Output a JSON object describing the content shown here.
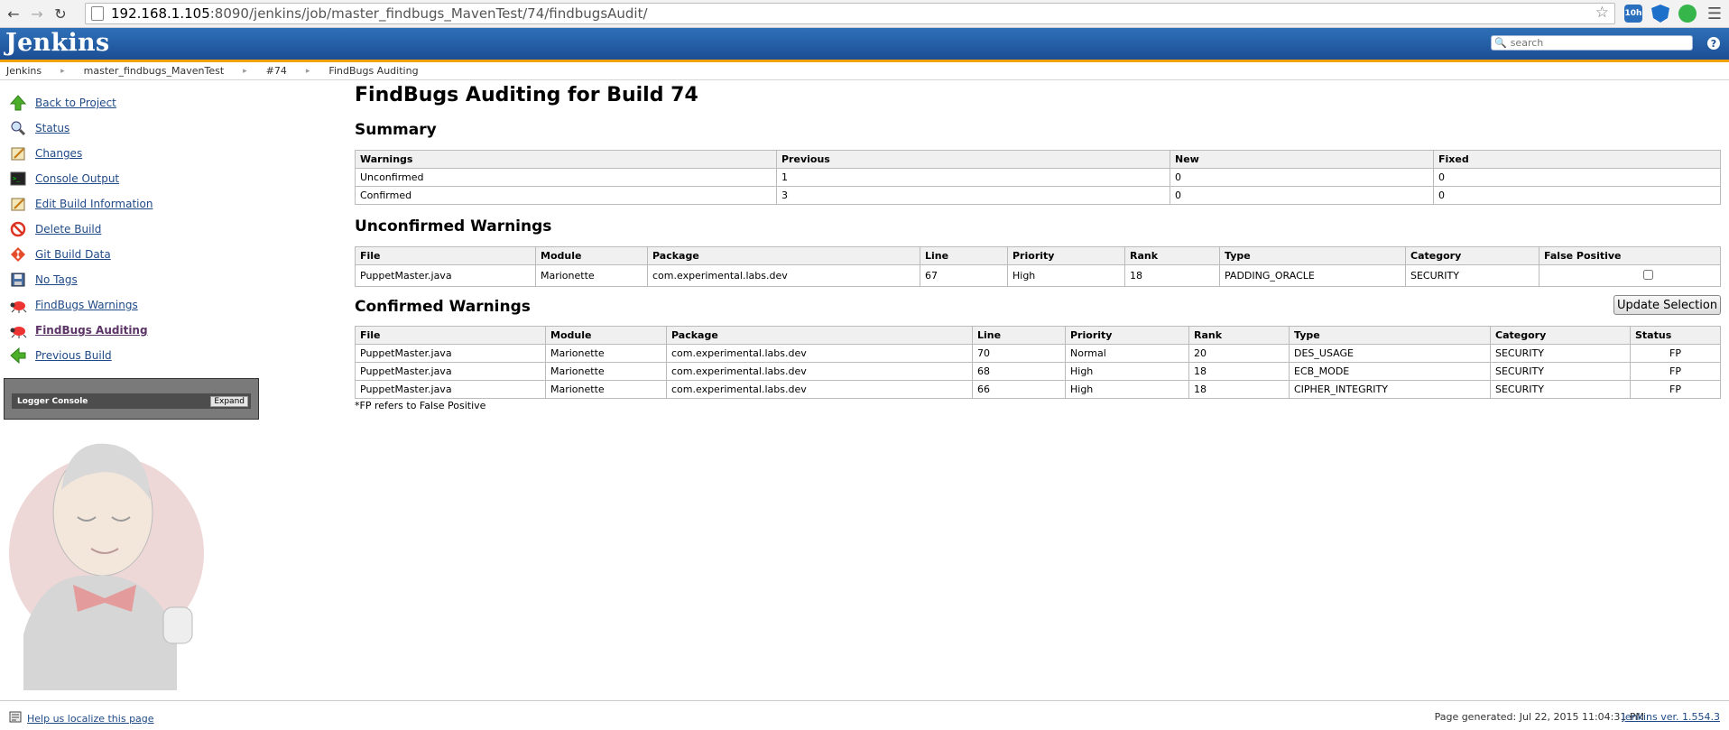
{
  "browser": {
    "url_host": "192.168.1.105",
    "url_path": ":8090/jenkins/job/master_findbugs_MavenTest/74/findbugsAudit/",
    "ext_badge": "10h"
  },
  "header": {
    "logo": "Jenkins",
    "search_placeholder": "search",
    "help": "?"
  },
  "breadcrumb": [
    "Jenkins",
    "master_findbugs_MavenTest",
    "#74",
    "FindBugs Auditing"
  ],
  "sidebar": {
    "items": [
      {
        "label": "Back to Project",
        "icon": "up-arrow-icon"
      },
      {
        "label": "Status",
        "icon": "search-icon"
      },
      {
        "label": "Changes",
        "icon": "notepad-icon"
      },
      {
        "label": "Console Output",
        "icon": "terminal-icon"
      },
      {
        "label": "Edit Build Information",
        "icon": "notepad-icon"
      },
      {
        "label": "Delete Build",
        "icon": "no-entry-icon"
      },
      {
        "label": "Git Build Data",
        "icon": "git-icon"
      },
      {
        "label": "No Tags",
        "icon": "save-icon"
      },
      {
        "label": "FindBugs Warnings",
        "icon": "bug-icon"
      },
      {
        "label": "FindBugs Auditing",
        "icon": "bug-icon"
      },
      {
        "label": "Previous Build",
        "icon": "left-arrow-icon"
      }
    ],
    "logger": {
      "title": "Logger Console",
      "expand": "Expand"
    }
  },
  "main": {
    "title": "FindBugs Auditing for Build 74",
    "summary_title": "Summary",
    "summary_headers": [
      "Warnings",
      "Previous",
      "New",
      "Fixed"
    ],
    "summary_rows": [
      [
        "Unconfirmed",
        "1",
        "0",
        "0"
      ],
      [
        "Confirmed",
        "3",
        "0",
        "0"
      ]
    ],
    "unconfirmed_title": "Unconfirmed Warnings",
    "unconfirmed_headers": [
      "File",
      "Module",
      "Package",
      "Line",
      "Priority",
      "Rank",
      "Type",
      "Category",
      "False Positive"
    ],
    "unconfirmed_rows": [
      [
        "PuppetMaster.java",
        "Marionette",
        "com.experimental.labs.dev",
        "67",
        "High",
        "18",
        "PADDING_ORACLE",
        "SECURITY"
      ]
    ],
    "confirmed_title": "Confirmed Warnings",
    "update_button": "Update Selection",
    "confirmed_headers": [
      "File",
      "Module",
      "Package",
      "Line",
      "Priority",
      "Rank",
      "Type",
      "Category",
      "Status"
    ],
    "confirmed_rows": [
      [
        "PuppetMaster.java",
        "Marionette",
        "com.experimental.labs.dev",
        "70",
        "Normal",
        "20",
        "DES_USAGE",
        "SECURITY",
        "FP"
      ],
      [
        "PuppetMaster.java",
        "Marionette",
        "com.experimental.labs.dev",
        "68",
        "High",
        "18",
        "ECB_MODE",
        "SECURITY",
        "FP"
      ],
      [
        "PuppetMaster.java",
        "Marionette",
        "com.experimental.labs.dev",
        "66",
        "High",
        "18",
        "CIPHER_INTEGRITY",
        "SECURITY",
        "FP"
      ]
    ],
    "footnote": "*FP refers to False Positive"
  },
  "footer": {
    "localize": "Help us localize this page",
    "generated": "Page generated: Jul 22, 2015 11:04:31 PM",
    "version": "Jenkins ver. 1.554.3"
  }
}
